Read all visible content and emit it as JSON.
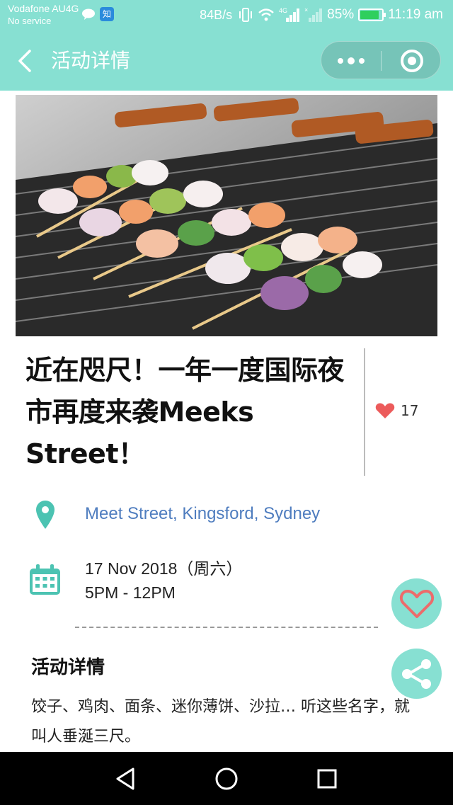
{
  "status_bar": {
    "carrier": "Vodafone AU4G",
    "service": "No service",
    "zhi_label": "知",
    "net_speed": "84B/s",
    "lte_label": "4G",
    "battery": "85%",
    "battery_level": 0.85,
    "time": "11:19 am"
  },
  "header": {
    "title": "活动详情",
    "accent_color": "#87e0d2"
  },
  "event": {
    "title": "近在咫尺！一年一度国际夜市再度来袭Meeks Street！",
    "likes": "17",
    "location": "Meet Street, Kingsford, Sydney",
    "date": "17 Nov 2018（周六）",
    "time": "5PM - 12PM",
    "carousel_index": 1,
    "carousel_count": 1
  },
  "details": {
    "heading": "活动详情",
    "text": "饺子、鸡肉、面条、迷你薄饼、沙拉… 听这些名字，就叫人垂涎三尺。"
  },
  "icons": {
    "back": "back-arrow-icon",
    "more": "more-dots-icon",
    "close": "target-close-icon",
    "location": "map-pin-icon",
    "calendar": "calendar-icon",
    "heart": "heart-icon",
    "share": "share-icon"
  }
}
